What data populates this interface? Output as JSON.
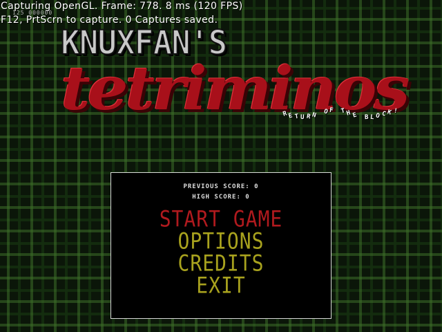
{
  "overlay": {
    "capture_status": "Capturing OpenGL.  Frame: 778. 8 ms (120 FPS)",
    "capture_hint": "F12, PrtScrn to capture. 0 Captures saved.",
    "hud_small": "125 000000"
  },
  "logo": {
    "top_text": "KNUXFAN'S",
    "main_text": "tetriminos",
    "tagline_letters": [
      "R",
      "E",
      "T",
      "U",
      "R",
      "N",
      " ",
      "O",
      "F",
      " ",
      "T",
      "H",
      "E",
      " ",
      "B",
      "L",
      "O",
      "C",
      "K",
      "!"
    ]
  },
  "scores": {
    "previous_label": "PREVIOUS SCORE:",
    "previous_value": "0",
    "high_label": "HIGH SCORE:",
    "high_value": "0"
  },
  "menu": {
    "items": [
      {
        "label": "START GAME",
        "selected": true
      },
      {
        "label": "OPTIONS",
        "selected": false
      },
      {
        "label": "CREDITS",
        "selected": false
      },
      {
        "label": "EXIT",
        "selected": false
      }
    ]
  },
  "colors": {
    "menu_selected": "#b01a1e",
    "menu_normal": "#a8a21e",
    "logo_red": "#a8101a",
    "logo_grey": "#c8c8c8",
    "panel_bg": "#000000",
    "panel_border": "#d8d8d8"
  }
}
